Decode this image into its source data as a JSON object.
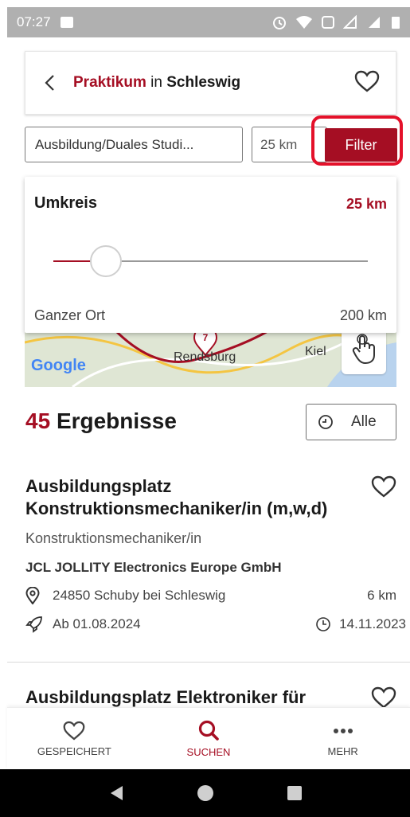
{
  "status_bar": {
    "time": "07:27"
  },
  "header": {
    "keyword": "Praktikum",
    "connector": "in",
    "location": "Schleswig"
  },
  "search": {
    "type_value": "Ausbildung/Duales Studi...",
    "radius_value": "25 km",
    "filter_label": "Filter"
  },
  "radius_panel": {
    "title": "Umkreis",
    "value": "25 km",
    "min_label": "Ganzer Ort",
    "max_label": "200 km",
    "slider_level": 0.125
  },
  "map": {
    "attribution": "Google",
    "pin_count": "7",
    "city_1": "Rendsburg",
    "city_2": "Kiel"
  },
  "results": {
    "count": "45",
    "label": "Ergebnisse",
    "filter_all_label": "Alle"
  },
  "jobs": [
    {
      "title": "Ausbildungsplatz Konstruktionsmechaniker/in (m,w,d)",
      "occupation": "Konstruktionsmechaniker/in",
      "company": "JCL JOLLITY Electronics Europe GmbH",
      "location": "24850 Schuby bei Schleswig",
      "distance": "6 km",
      "start": "Ab 01.08.2024",
      "posted": "14.11.2023"
    },
    {
      "title": "Ausbildungsplatz Elektroniker für"
    }
  ],
  "bottom_nav": {
    "saved": "GESPEICHERT",
    "search": "SUCHEN",
    "more": "MEHR"
  },
  "colors": {
    "accent": "#a50e23",
    "highlight": "#e4112a"
  }
}
